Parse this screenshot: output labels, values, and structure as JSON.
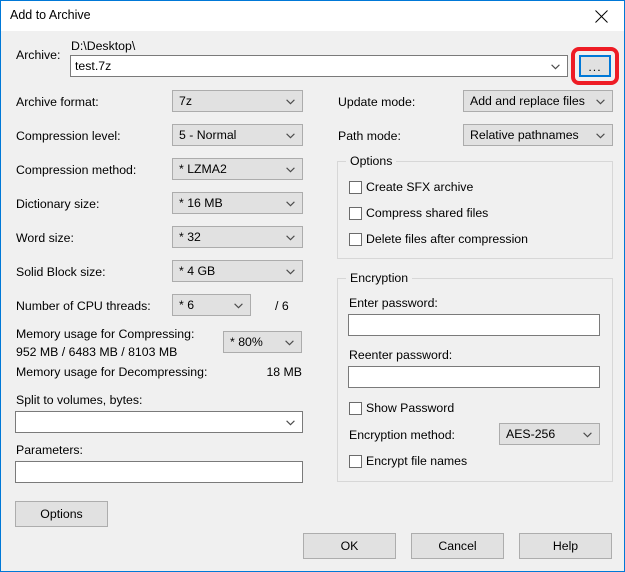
{
  "window": {
    "title": "Add to Archive",
    "close_icon": "close-icon",
    "accent_color": "#0078d7",
    "highlight_color": "#ee1c25",
    "background_color": "#f0f0f0"
  },
  "archive": {
    "label": "Archive:",
    "path": "D:\\Desktop\\",
    "filename": "test.7z",
    "browse_label": "...",
    "browse_icon": "ellipsis-icon"
  },
  "left": {
    "archive_format": {
      "label": "Archive format:",
      "value": "7z"
    },
    "compression_level": {
      "label": "Compression level:",
      "value": "5 - Normal"
    },
    "compression_method": {
      "label": "Compression method:",
      "value": "*  LZMA2"
    },
    "dictionary_size": {
      "label": "Dictionary size:",
      "value": "*  16 MB"
    },
    "word_size": {
      "label": "Word size:",
      "value": "*  32"
    },
    "solid_block_size": {
      "label": "Solid Block size:",
      "value": "*  4 GB"
    },
    "cpu_threads": {
      "label": "Number of CPU threads:",
      "value": "*  6",
      "total": "/ 6"
    },
    "memory_compressing": {
      "label": "Memory usage for Compressing:",
      "detail": "952 MB / 6483 MB / 8103 MB",
      "value": "* 80%"
    },
    "memory_decompressing": {
      "label": "Memory usage for Decompressing:",
      "value": "18 MB"
    },
    "split_to_volumes": {
      "label": "Split to volumes, bytes:",
      "value": ""
    },
    "parameters": {
      "label": "Parameters:",
      "value": ""
    }
  },
  "right": {
    "update_mode": {
      "label": "Update mode:",
      "value": "Add and replace files"
    },
    "path_mode": {
      "label": "Path mode:",
      "value": "Relative pathnames"
    },
    "options": {
      "legend": "Options",
      "items": [
        {
          "label": "Create SFX archive",
          "checked": false
        },
        {
          "label": "Compress shared files",
          "checked": false
        },
        {
          "label": "Delete files after compression",
          "checked": false
        }
      ]
    },
    "encryption": {
      "legend": "Encryption",
      "enter_password_label": "Enter password:",
      "enter_password_value": "",
      "reenter_password_label": "Reenter password:",
      "reenter_password_value": "",
      "show_password": {
        "label": "Show Password",
        "checked": false
      },
      "method_label": "Encryption method:",
      "method_value": "AES-256",
      "encrypt_file_names": {
        "label": "Encrypt file names",
        "checked": false
      }
    }
  },
  "footer": {
    "options_label": "Options",
    "ok_label": "OK",
    "cancel_label": "Cancel",
    "help_label": "Help"
  }
}
